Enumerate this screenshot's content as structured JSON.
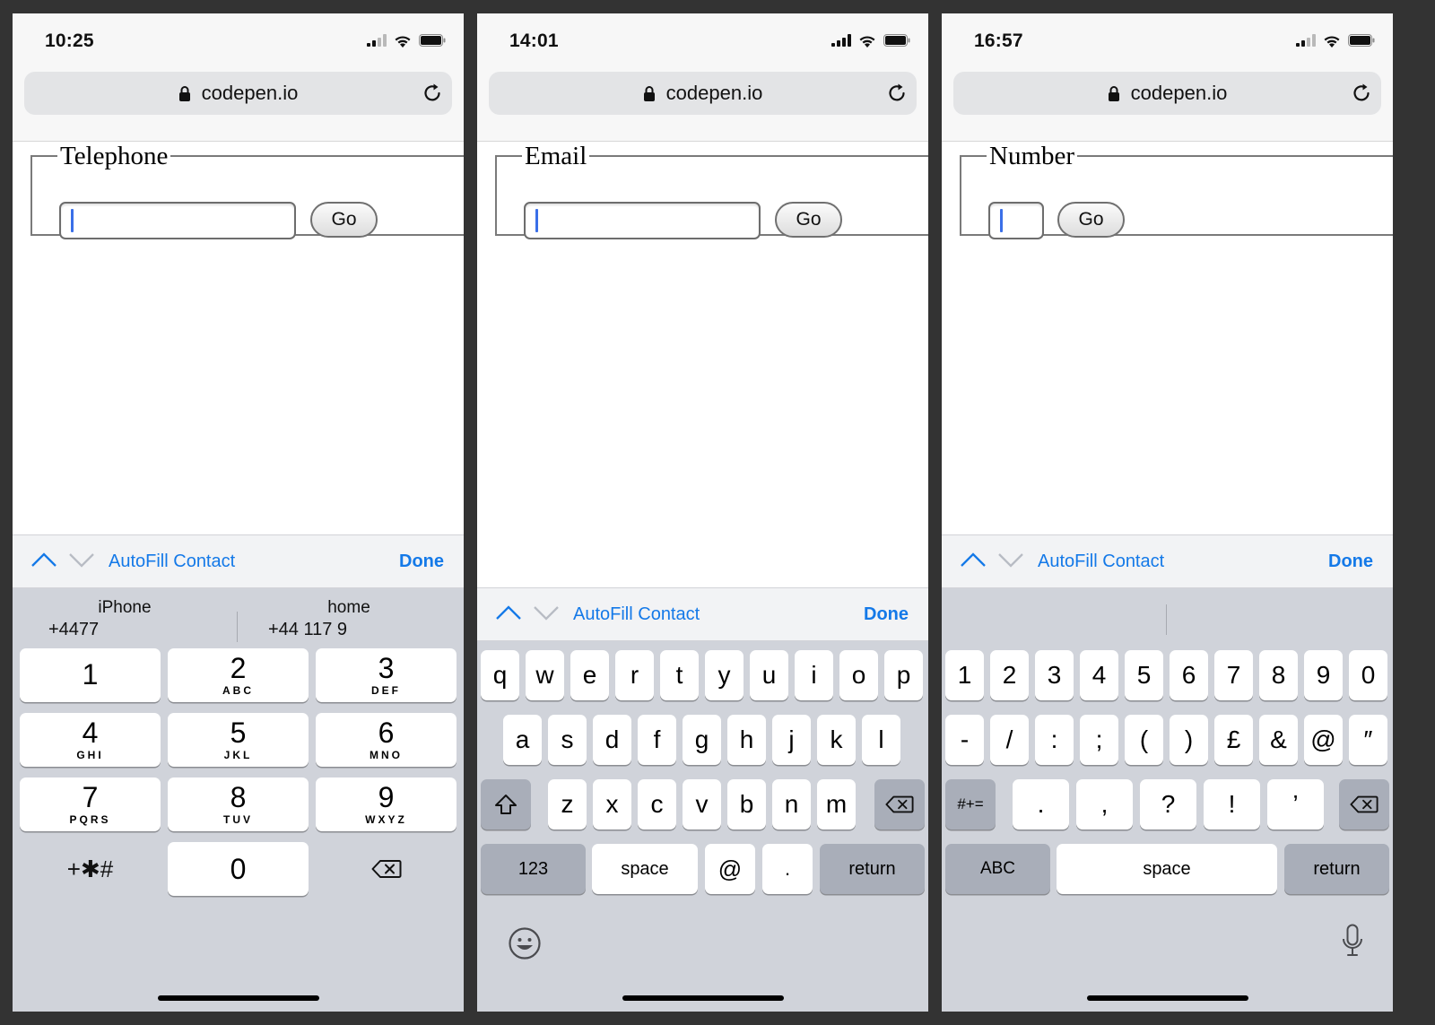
{
  "phones": [
    {
      "time": "10:25",
      "url": "codepen.io",
      "form": {
        "legend": "Telephone",
        "button": "Go"
      },
      "accessory": {
        "autofill": "AutoFill Contact",
        "done": "Done"
      },
      "suggestions": [
        {
          "label": "iPhone",
          "value": "+4477"
        },
        {
          "label": "home",
          "value": "+44 117 9"
        }
      ],
      "keypad": [
        {
          "digit": "1",
          "letters": ""
        },
        {
          "digit": "2",
          "letters": "ABC"
        },
        {
          "digit": "3",
          "letters": "DEF"
        },
        {
          "digit": "4",
          "letters": "GHI"
        },
        {
          "digit": "5",
          "letters": "JKL"
        },
        {
          "digit": "6",
          "letters": "MNO"
        },
        {
          "digit": "7",
          "letters": "PQRS"
        },
        {
          "digit": "8",
          "letters": "TUV"
        },
        {
          "digit": "9",
          "letters": "WXYZ"
        }
      ],
      "symbols_key": "+✱#",
      "zero_key": "0"
    },
    {
      "time": "14:01",
      "url": "codepen.io",
      "form": {
        "legend": "Email",
        "button": "Go"
      },
      "accessory": {
        "autofill": "AutoFill Contact",
        "done": "Done"
      },
      "rows": [
        [
          "q",
          "w",
          "e",
          "r",
          "t",
          "y",
          "u",
          "i",
          "o",
          "p"
        ],
        [
          "a",
          "s",
          "d",
          "f",
          "g",
          "h",
          "j",
          "k",
          "l"
        ],
        [
          "z",
          "x",
          "c",
          "v",
          "b",
          "n",
          "m"
        ]
      ],
      "bottom": {
        "numbers": "123",
        "space": "space",
        "at": "@",
        "dot": ".",
        "return": "return"
      }
    },
    {
      "time": "16:57",
      "url": "codepen.io",
      "form": {
        "legend": "Number",
        "button": "Go"
      },
      "accessory": {
        "autofill": "AutoFill Contact",
        "done": "Done"
      },
      "rows": [
        [
          "1",
          "2",
          "3",
          "4",
          "5",
          "6",
          "7",
          "8",
          "9",
          "0"
        ],
        [
          "-",
          "/",
          ":",
          ";",
          "(",
          ")",
          "£",
          "&",
          "@",
          "″"
        ],
        [
          ".",
          ",",
          "?",
          "!",
          "’"
        ]
      ],
      "bottom": {
        "more_symbols": "#+=",
        "abc": "ABC",
        "space": "space",
        "return": "return"
      }
    }
  ],
  "colors": {
    "accent": "#1479e8",
    "caret": "#3a6fe8",
    "keyboard_bg": "#d0d3da",
    "dark_key": "#a9aeb9"
  }
}
